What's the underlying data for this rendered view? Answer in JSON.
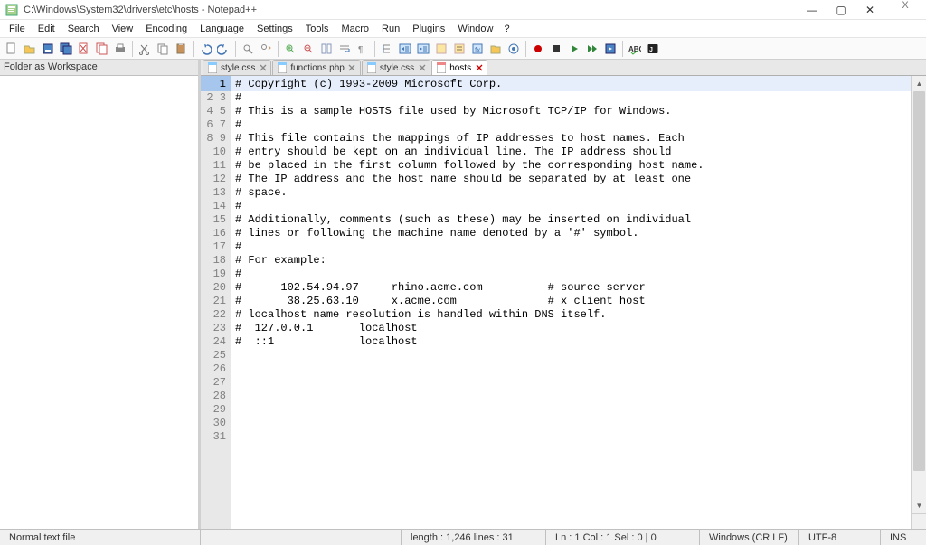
{
  "window": {
    "title": "C:\\Windows\\System32\\drivers\\etc\\hosts - Notepad++",
    "min": "—",
    "max": "▢",
    "close": "✕",
    "extra_x": "X"
  },
  "menubar": [
    "File",
    "Edit",
    "Search",
    "View",
    "Encoding",
    "Language",
    "Settings",
    "Tools",
    "Macro",
    "Run",
    "Plugins",
    "Window",
    "?"
  ],
  "sidebar": {
    "title": "Folder as Workspace"
  },
  "tabs": [
    {
      "icon": "file-blue",
      "label": "style.css",
      "active": false
    },
    {
      "icon": "file-blue",
      "label": "functions.php",
      "active": false
    },
    {
      "icon": "file-blue",
      "label": "style.css",
      "active": false
    },
    {
      "icon": "file-orange",
      "label": "hosts",
      "active": true
    }
  ],
  "code_lines": [
    "# Copyright (c) 1993-2009 Microsoft Corp.",
    "#",
    "# This is a sample HOSTS file used by Microsoft TCP/IP for Windows.",
    "#",
    "# This file contains the mappings of IP addresses to host names. Each",
    "# entry should be kept on an individual line. The IP address should",
    "# be placed in the first column followed by the corresponding host name.",
    "# The IP address and the host name should be separated by at least one",
    "# space.",
    "#",
    "# Additionally, comments (such as these) may be inserted on individual",
    "# lines or following the machine name denoted by a '#' symbol.",
    "#",
    "# For example:",
    "#",
    "#      102.54.94.97     rhino.acme.com          # source server",
    "#       38.25.63.10     x.acme.com              # x client host",
    "# localhost name resolution is handled within DNS itself.",
    "#  127.0.0.1       localhost",
    "#  ::1             localhost",
    ""
  ],
  "visible_line_count": 31,
  "statusbar": {
    "filetype": "Normal text file",
    "length": "length : 1,246    lines : 31",
    "position": "Ln : 1    Col : 1    Sel : 0 | 0",
    "eol": "Windows (CR LF)",
    "encoding": "UTF-8",
    "mode": "INS"
  }
}
